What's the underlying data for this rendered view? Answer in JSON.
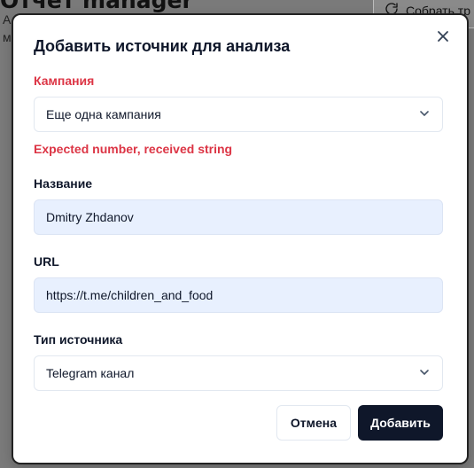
{
  "background": {
    "page_title": "Отчет manager",
    "subtitle_1": "А",
    "subtitle_2": "м",
    "collect_button": "Собрать тр"
  },
  "dialog": {
    "title": "Добавить источник для анализа",
    "campaign": {
      "label": "Кампания",
      "value": "Еще одна кампания",
      "error": "Expected number, received string"
    },
    "name": {
      "label": "Название",
      "value": "Dmitry Zhdanov"
    },
    "url": {
      "label": "URL",
      "value": "https://t.me/children_and_food"
    },
    "source_type": {
      "label": "Тип источника",
      "value": "Telegram канал"
    },
    "cancel_label": "Отмена",
    "submit_label": "Добавить"
  },
  "colors": {
    "error": "#dc3545",
    "primary": "#0f172a",
    "input_autofill_bg": "#e8f0fe"
  },
  "icons": [
    "close-icon",
    "chevron-down-icon",
    "refresh-icon"
  ]
}
